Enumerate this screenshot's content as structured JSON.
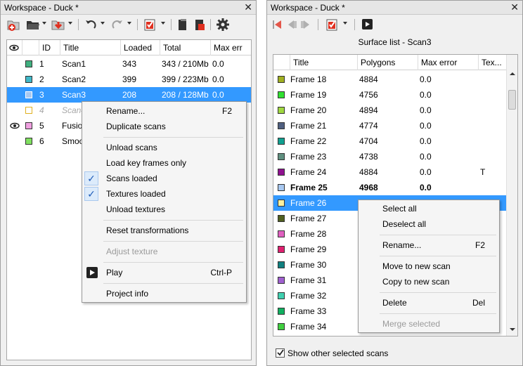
{
  "left": {
    "title": "Workspace - Duck *",
    "close": "✕",
    "columns": [
      "ID",
      "Title",
      "Loaded",
      "Total",
      "Max err"
    ],
    "rows": [
      {
        "id": "1",
        "title": "Scan1",
        "loaded": "343",
        "total": "343 / 210Mb",
        "max_err": "0.0",
        "color": "#40b080",
        "visible": false,
        "state": "normal"
      },
      {
        "id": "2",
        "title": "Scan2",
        "loaded": "399",
        "total": "399 / 223Mb",
        "max_err": "0.0",
        "color": "#40b8c8",
        "visible": false,
        "state": "normal"
      },
      {
        "id": "3",
        "title": "Scan3",
        "loaded": "208",
        "total": "208 / 128Mb",
        "max_err": "0.0",
        "color": "#a8c8f0",
        "visible": false,
        "state": "selected"
      },
      {
        "id": "4",
        "title": "Scan4",
        "loaded": "",
        "total": "",
        "max_err": "",
        "color": "#ffffff",
        "visible": false,
        "state": "unloaded"
      },
      {
        "id": "5",
        "title": "Fusio",
        "loaded": "",
        "total": "",
        "max_err": "",
        "color": "#f0a0e0",
        "visible": true,
        "state": "normal"
      },
      {
        "id": "6",
        "title": "Smoo",
        "loaded": "",
        "total": "",
        "max_err": "",
        "color": "#80e060",
        "visible": false,
        "state": "normal"
      }
    ],
    "menu": {
      "rename": "Rename...",
      "rename_sc": "F2",
      "duplicate": "Duplicate scans",
      "unload_scans": "Unload scans",
      "load_key": "Load key frames only",
      "scans_loaded": "Scans loaded",
      "textures_loaded": "Textures loaded",
      "unload_textures": "Unload textures",
      "reset": "Reset transformations",
      "adjust": "Adjust texture",
      "play": "Play",
      "play_sc": "Ctrl-P",
      "project_info": "Project info"
    }
  },
  "right": {
    "title": "Workspace - Duck *",
    "close": "✕",
    "surface_label": "Surface list - Scan3",
    "columns": [
      "Title",
      "Polygons",
      "Max error",
      "Tex..."
    ],
    "rows": [
      {
        "title": "Frame 18",
        "polygons": "4884",
        "max_error": "0.0",
        "tex": "",
        "color": "#a0b020",
        "state": "normal"
      },
      {
        "title": "Frame 19",
        "polygons": "4756",
        "max_error": "0.0",
        "tex": "",
        "color": "#30e030",
        "state": "normal"
      },
      {
        "title": "Frame 20",
        "polygons": "4894",
        "max_error": "0.0",
        "tex": "",
        "color": "#a0d840",
        "state": "normal"
      },
      {
        "title": "Frame 21",
        "polygons": "4774",
        "max_error": "0.0",
        "tex": "",
        "color": "#506080",
        "state": "normal"
      },
      {
        "title": "Frame 22",
        "polygons": "4704",
        "max_error": "0.0",
        "tex": "",
        "color": "#10a090",
        "state": "normal"
      },
      {
        "title": "Frame 23",
        "polygons": "4738",
        "max_error": "0.0",
        "tex": "",
        "color": "#609080",
        "state": "normal"
      },
      {
        "title": "Frame 24",
        "polygons": "4884",
        "max_error": "0.0",
        "tex": "T",
        "color": "#901090",
        "state": "normal"
      },
      {
        "title": "Frame 25",
        "polygons": "4968",
        "max_error": "0.0",
        "tex": "",
        "color": "#a8c8f0",
        "state": "bold"
      },
      {
        "title": "Frame 26",
        "polygons": "",
        "max_error": "",
        "tex": "",
        "color": "#f8f0a0",
        "state": "selected"
      },
      {
        "title": "Frame 27",
        "polygons": "",
        "max_error": "",
        "tex": "",
        "color": "#506020",
        "state": "normal"
      },
      {
        "title": "Frame 28",
        "polygons": "",
        "max_error": "",
        "tex": "",
        "color": "#e060c0",
        "state": "normal"
      },
      {
        "title": "Frame 29",
        "polygons": "",
        "max_error": "",
        "tex": "",
        "color": "#e02070",
        "state": "normal"
      },
      {
        "title": "Frame 30",
        "polygons": "",
        "max_error": "",
        "tex": "",
        "color": "#108080",
        "state": "normal"
      },
      {
        "title": "Frame 31",
        "polygons": "",
        "max_error": "",
        "tex": "",
        "color": "#a060d0",
        "state": "normal"
      },
      {
        "title": "Frame 32",
        "polygons": "",
        "max_error": "",
        "tex": "",
        "color": "#40d0b0",
        "state": "normal"
      },
      {
        "title": "Frame 33",
        "polygons": "",
        "max_error": "",
        "tex": "",
        "color": "#10b060",
        "state": "normal"
      },
      {
        "title": "Frame 34",
        "polygons": "",
        "max_error": "",
        "tex": "",
        "color": "#40d040",
        "state": "normal"
      }
    ],
    "menu": {
      "select_all": "Select all",
      "deselect_all": "Deselect all",
      "rename": "Rename...",
      "rename_sc": "F2",
      "move": "Move to new scan",
      "copy": "Copy to new scan",
      "delete": "Delete",
      "delete_sc": "Del",
      "merge": "Merge selected"
    },
    "show_other": "Show other selected scans",
    "show_other_checked": true
  },
  "colors": {
    "selection": "#3399ff",
    "accent_red": "#e03020"
  }
}
